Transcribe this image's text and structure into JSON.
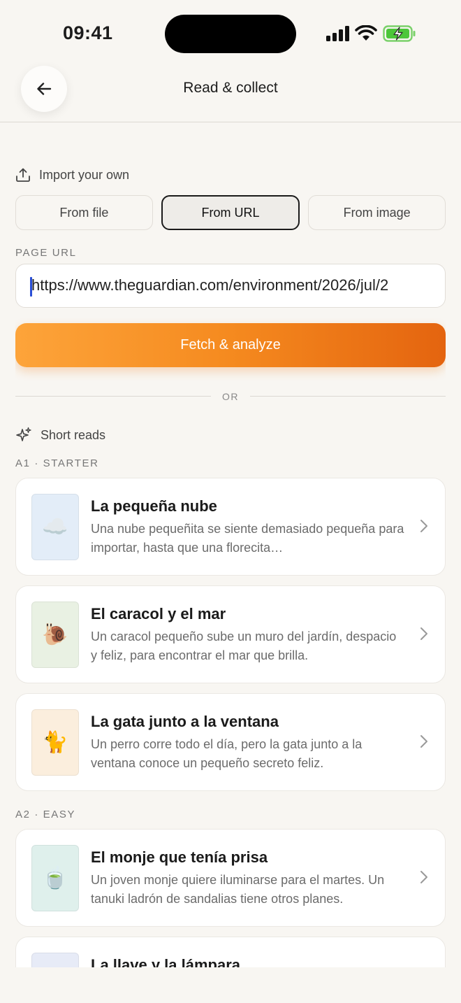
{
  "status_bar": {
    "time": "09:41"
  },
  "header": {
    "title": "Read & collect"
  },
  "import": {
    "heading": "Import your own",
    "tabs": [
      {
        "label": "From file",
        "active": false
      },
      {
        "label": "From URL",
        "active": true
      },
      {
        "label": "From image",
        "active": false
      }
    ],
    "url_label": "PAGE URL",
    "url_value": "https://www.theguardian.com/environment/2026/jul/2",
    "fetch_label": "Fetch & analyze",
    "or_label": "OR"
  },
  "short_reads": {
    "heading": "Short reads",
    "levels": [
      {
        "label": "A1 · STARTER",
        "stories": [
          {
            "title": "La pequeña nube",
            "desc": "Una nube pequeñita se siente demasiado pequeña para importar, hasta que una florecita…",
            "icon": "cloud-icon",
            "emoji": "☁️",
            "thumb_color": "#e3edf8"
          },
          {
            "title": "El caracol y el mar",
            "desc": "Un caracol pequeño sube un muro del jardín, despacio y feliz, para encontrar el mar que brilla.",
            "icon": "snail-icon",
            "emoji": "🐌",
            "thumb_color": "#e9f1e3"
          },
          {
            "title": "La gata junto a la ventana",
            "desc": "Un perro corre todo el día, pero la gata junto a la ventana conoce un pequeño secreto feliz.",
            "icon": "cat-icon",
            "emoji": "🐈",
            "thumb_color": "#fbeedd"
          }
        ]
      },
      {
        "label": "A2 · EASY",
        "stories": [
          {
            "title": "El monje que tenía prisa",
            "desc": "Un joven monje quiere iluminarse para el martes. Un tanuki ladrón de sandalias tiene otros planes.",
            "icon": "teapot-icon",
            "emoji": "🍵",
            "thumb_color": "#dff0ec"
          },
          {
            "title": "La llave y la lámpara",
            "desc": "",
            "icon": "key-icon",
            "emoji": "",
            "thumb_color": "#e7ebf7"
          }
        ]
      }
    ]
  }
}
